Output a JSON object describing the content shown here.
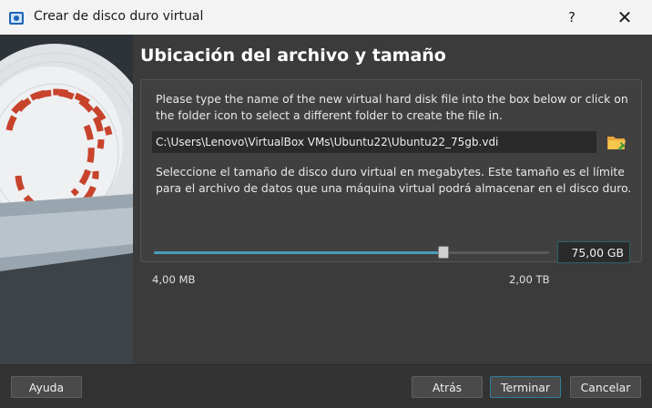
{
  "window": {
    "title": "Crear de disco duro virtual",
    "help_label": "?",
    "close_label": "✕"
  },
  "page": {
    "title": "Ubicación del archivo y tamaño"
  },
  "location": {
    "description": "Please type the name of the new virtual hard disk file into the box below or click on the folder icon to select a different folder to create the file in.",
    "path_value": "C:\\Users\\Lenovo\\VirtualBox VMs\\Ubuntu22\\Ubuntu22_75gb.vdi",
    "folder_icon": "folder-open-icon"
  },
  "size": {
    "description": "Seleccione el tamaño de disco duro virtual en megabytes. Este tamaño es el límite para el archivo de datos que una máquina virtual podrá almacenar en el disco duro.",
    "value": "75,00 GB",
    "min_label": "4,00 MB",
    "max_label": "2,00 TB",
    "slider_fraction": 0.74,
    "accent_color": "#4a9fb9"
  },
  "buttons": {
    "help": "Ayuda",
    "back": "Atrás",
    "finish": "Terminar",
    "cancel": "Cancelar"
  }
}
